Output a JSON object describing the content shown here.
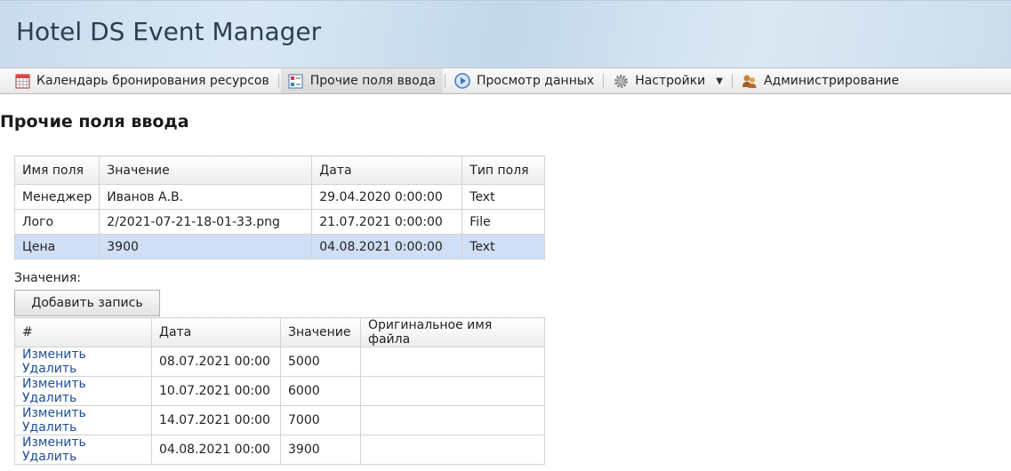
{
  "app": {
    "title": "Hotel DS Event Manager"
  },
  "menu": {
    "items": [
      {
        "label": "Календарь бронирования ресурсов",
        "icon": "calendar-icon"
      },
      {
        "label": "Прочие поля ввода",
        "icon": "form-fields-icon",
        "active": true
      },
      {
        "label": "Просмотр данных",
        "icon": "play-icon"
      },
      {
        "label": "Настройки",
        "icon": "gear-icon"
      },
      {
        "label": "Администрирование",
        "icon": "admin-users-icon"
      }
    ]
  },
  "page": {
    "title": "Прочие поля ввода"
  },
  "fields_table": {
    "headers": [
      "Имя поля",
      "Значение",
      "Дата",
      "Тип поля"
    ],
    "rows": [
      {
        "name": "Менеджер",
        "value": "Иванов А.В.",
        "date": "29.04.2020 0:00:00",
        "type": "Text"
      },
      {
        "name": "Лого",
        "value": "2/2021-07-21-18-01-33.png",
        "date": "21.07.2021 0:00:00",
        "type": "File"
      },
      {
        "name": "Цена",
        "value": "3900",
        "date": "04.08.2021 0:00:00",
        "type": "Text",
        "selected": true
      }
    ]
  },
  "values_section": {
    "label": "Значения:",
    "add_button": "Добавить запись",
    "headers": [
      "#",
      "Дата",
      "Значение",
      "Оригинальное имя файла"
    ],
    "edit_label": "Изменить",
    "delete_label": "Удалить",
    "rows": [
      {
        "date": "08.07.2021 00:00",
        "value": "5000",
        "filename": ""
      },
      {
        "date": "10.07.2021 00:00",
        "value": "6000",
        "filename": ""
      },
      {
        "date": "14.07.2021 00:00",
        "value": "7000",
        "filename": ""
      },
      {
        "date": "04.08.2021 00:00",
        "value": "3900",
        "filename": ""
      }
    ]
  }
}
